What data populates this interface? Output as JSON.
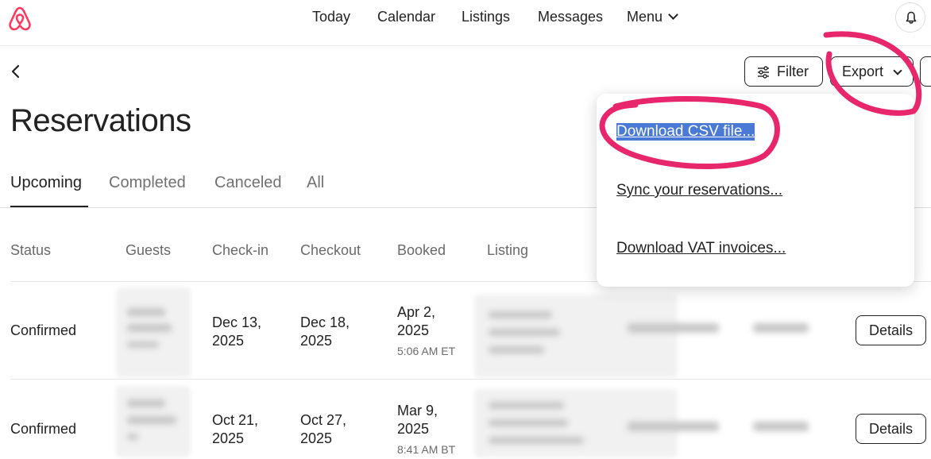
{
  "nav": {
    "items": [
      "Today",
      "Calendar",
      "Listings",
      "Messages"
    ],
    "menu_label": "Menu"
  },
  "toolbar": {
    "filter_label": "Filter",
    "export_label": "Export"
  },
  "page": {
    "title": "Reservations"
  },
  "tabs": [
    {
      "label": "Upcoming",
      "active": true
    },
    {
      "label": "Completed",
      "active": false
    },
    {
      "label": "Canceled",
      "active": false
    },
    {
      "label": "All",
      "active": false
    }
  ],
  "table": {
    "headers": [
      "Status",
      "Guests",
      "Check-in",
      "Checkout",
      "Booked",
      "Listing"
    ],
    "rows": [
      {
        "status": "Confirmed",
        "checkin_line1": "Dec 13,",
        "checkin_line2": "2025",
        "checkout_line1": "Dec 18,",
        "checkout_line2": "2025",
        "booked_line1": "Apr 2,",
        "booked_line2": "2025",
        "booked_time": "5:06 AM ET",
        "action": "Details"
      },
      {
        "status": "Confirmed",
        "checkin_line1": "Oct 21,",
        "checkin_line2": "2025",
        "checkout_line1": "Oct 27,",
        "checkout_line2": "2025",
        "booked_line1": "Mar 9,",
        "booked_line2": "2025",
        "booked_time": "8:41 AM BT",
        "action": "Details"
      }
    ]
  },
  "export_menu": {
    "items": [
      {
        "label": "Download CSV file...",
        "selected": true
      },
      {
        "label": "Sync your reservations...",
        "selected": false
      },
      {
        "label": "Download VAT invoices...",
        "selected": false
      }
    ]
  },
  "colors": {
    "brand": "#ff385c",
    "annotation": "#e8266c",
    "selection": "#4a79d6",
    "text": "#222222",
    "muted": "#717171"
  },
  "icons": [
    "airbnb-logo",
    "chevron-down-icon",
    "bell-icon",
    "back-arrow-icon",
    "filter-sliders-icon"
  ]
}
